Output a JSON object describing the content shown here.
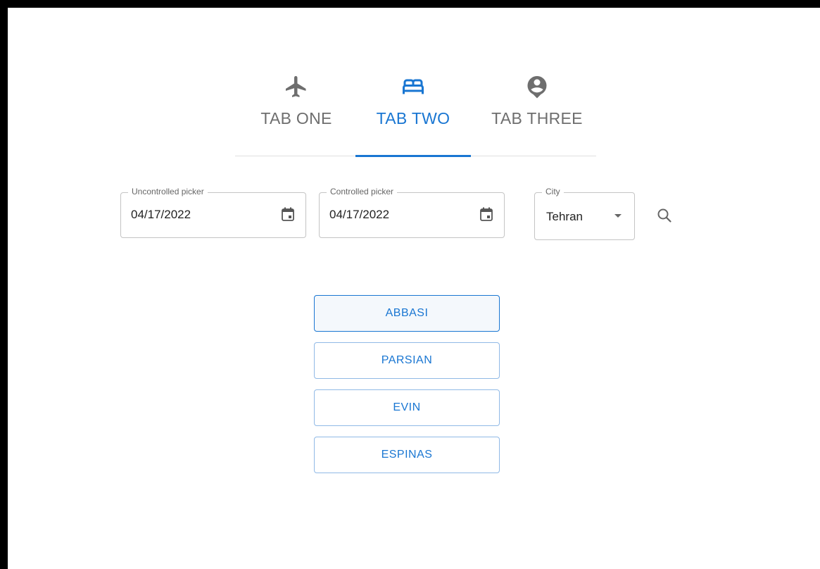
{
  "tabs": [
    {
      "label": "TAB ONE",
      "icon": "airplane-icon",
      "active": false
    },
    {
      "label": "TAB TWO",
      "icon": "hotel-bed-icon",
      "active": true
    },
    {
      "label": "TAB THREE",
      "icon": "account-pin-icon",
      "active": false
    }
  ],
  "filters": {
    "uncontrolled_picker": {
      "label": "Uncontrolled picker",
      "value": "04/17/2022",
      "icon": "calendar-icon"
    },
    "controlled_picker": {
      "label": "Controlled picker",
      "value": "04/17/2022",
      "icon": "calendar-icon"
    },
    "city": {
      "label": "City",
      "value": "Tehran",
      "icon": "caret-down-icon"
    },
    "search_icon": "search-icon"
  },
  "hotels": [
    {
      "label": "ABBASI",
      "selected": true
    },
    {
      "label": "PARSIAN",
      "selected": false
    },
    {
      "label": "EVIN",
      "selected": false
    },
    {
      "label": "ESPINAS",
      "selected": false
    }
  ],
  "colors": {
    "primary": "#1976d2",
    "inactive_tab": "#6e6e6e",
    "border": "#c4c4c4"
  }
}
